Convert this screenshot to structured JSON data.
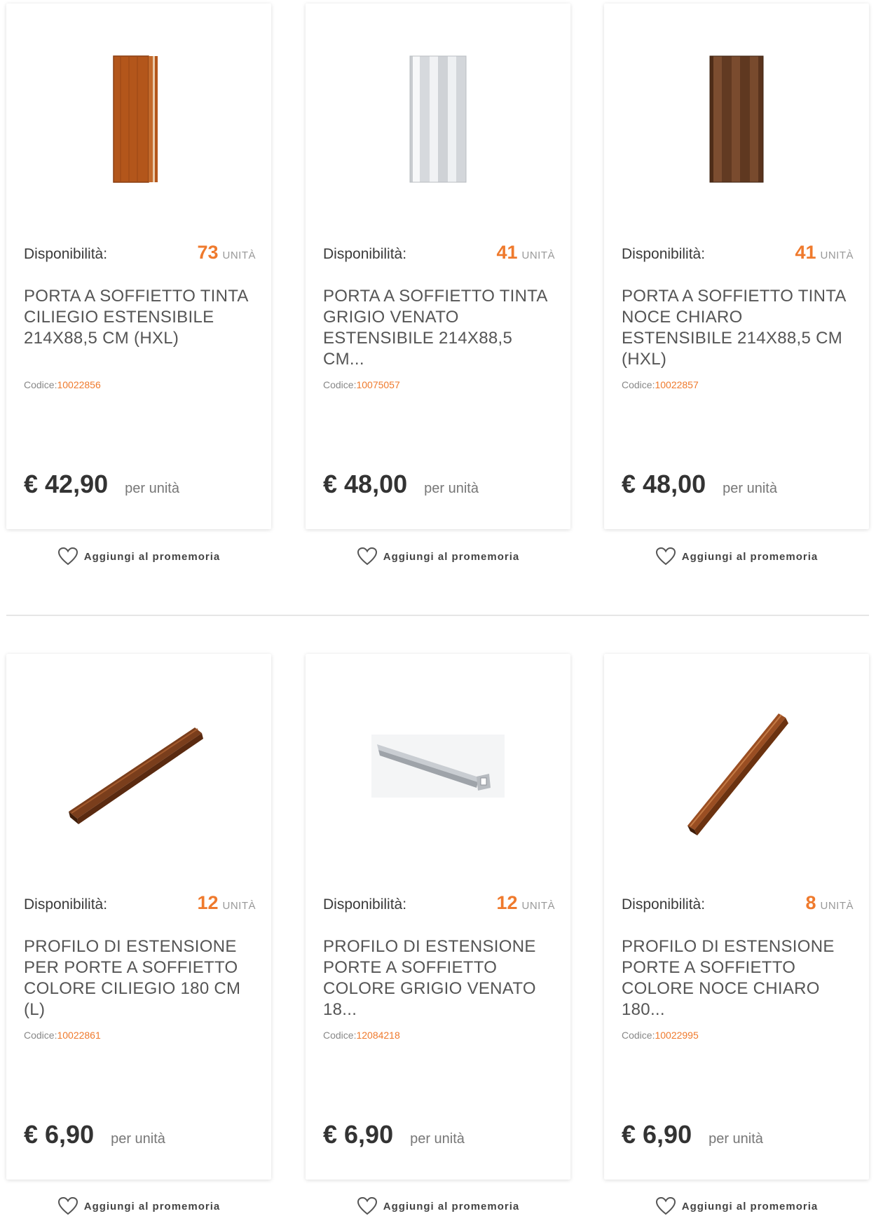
{
  "common": {
    "availability_label": "Disponibilità:",
    "unit_label": "UNITÀ",
    "code_label": "Codice:",
    "per_unit_label": "per unità",
    "reminder_label": "Aggiungi al promemoria"
  },
  "products": [
    {
      "image": "door-cherry",
      "quantity": "73",
      "title": "PORTA A SOFFIETTO TINTA CILIEGIO ESTENSIBILE 214X88,5 CM (HXL)",
      "code": "10022856",
      "price": "€ 42,90"
    },
    {
      "image": "door-grey",
      "quantity": "41",
      "title": "PORTA A SOFFIETTO TINTA GRIGIO VENATO ESTENSIBILE 214X88,5 CM...",
      "code": "10075057",
      "price": "€ 48,00"
    },
    {
      "image": "door-walnut",
      "quantity": "41",
      "title": "PORTA A SOFFIETTO TINTA NOCE CHIARO ESTENSIBILE 214X88,5 CM (HXL)",
      "code": "10022857",
      "price": "€ 48,00"
    },
    {
      "image": "profile-cherry",
      "quantity": "12",
      "title": "PROFILO DI ESTENSIONE PER PORTE A SOFFIETTO COLORE CILIEGIO 180 CM (L)",
      "code": "10022861",
      "price": "€ 6,90"
    },
    {
      "image": "profile-grey",
      "quantity": "12",
      "title": "PROFILO DI ESTENSIONE PORTE A SOFFIETTO COLORE GRIGIO VENATO 18...",
      "code": "12084218",
      "price": "€ 6,90"
    },
    {
      "image": "profile-walnut",
      "quantity": "8",
      "title": "PROFILO DI ESTENSIONE PORTE A SOFFIETTO COLORE NOCE CHIARO 180...",
      "code": "10022995",
      "price": "€ 6,90"
    }
  ],
  "colors": {
    "accent": "#ef7a2d",
    "text": "#333333",
    "divider": "#e6e6e6"
  }
}
